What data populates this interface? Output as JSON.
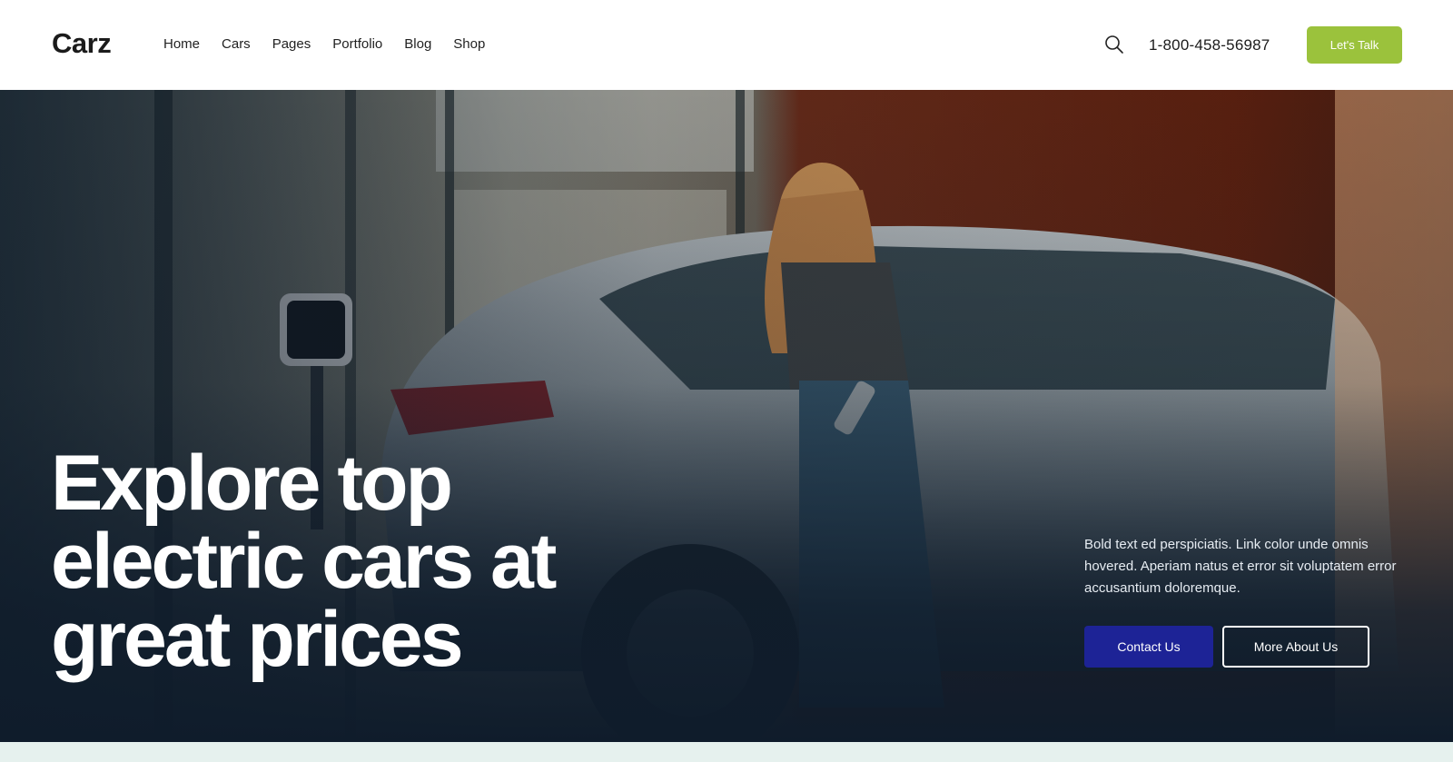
{
  "header": {
    "logo": "Carz",
    "nav": [
      "Home",
      "Cars",
      "Pages",
      "Portfolio",
      "Blog",
      "Shop"
    ],
    "search_icon": "search-icon",
    "phone": "1-800-458-56987",
    "cta_label": "Let's Talk"
  },
  "hero": {
    "title_lines": [
      "Explore top",
      "electric cars at",
      "great prices"
    ],
    "description": "Bold text ed perspiciatis. Link color unde omnis hovered. Aperiam natus et error sit voluptatem error accusantium doloremque.",
    "primary_button": "Contact Us",
    "secondary_button": "More About Us"
  },
  "colors": {
    "accent_green": "#9bc23c",
    "primary_blue": "#1d2396",
    "hero_dark": "#0f1c2b",
    "band": "#e6f1ee"
  }
}
